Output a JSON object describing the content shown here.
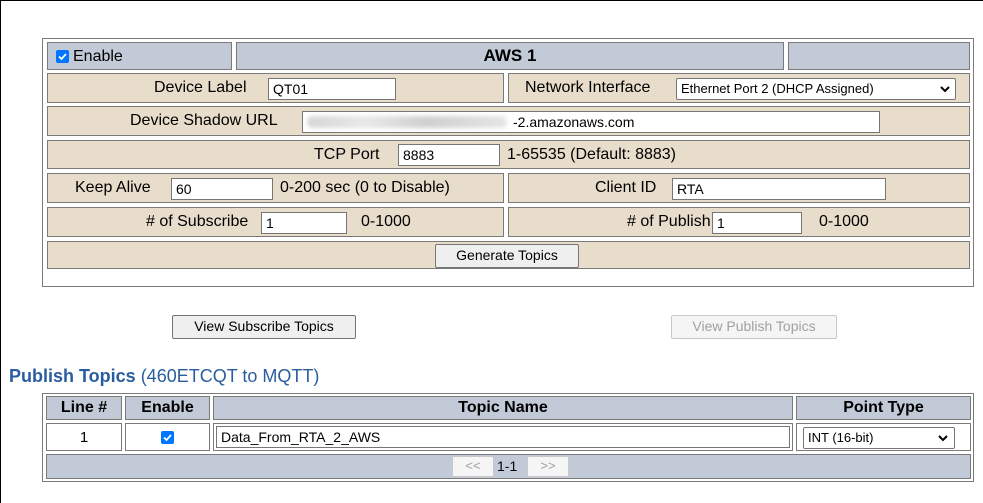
{
  "config": {
    "enable_label": "Enable",
    "enable_checked": true,
    "title": "AWS 1",
    "device_label": {
      "label": "Device Label",
      "value": "QT01"
    },
    "network_interface": {
      "label": "Network Interface",
      "value": "Ethernet Port 2 (DHCP Assigned)"
    },
    "device_shadow_url": {
      "label": "Device Shadow URL",
      "value_suffix": "-2.amazonaws.com"
    },
    "tcp_port": {
      "label": "TCP Port",
      "value": "8883",
      "hint": "1-65535 (Default: 8883)"
    },
    "keep_alive": {
      "label": "Keep Alive",
      "value": "60",
      "hint": "0-200 sec (0 to Disable)"
    },
    "client_id": {
      "label": "Client ID",
      "value": "RTA"
    },
    "num_subscribe": {
      "label": "# of Subscribe",
      "value": "1",
      "hint": "0-1000"
    },
    "num_publish": {
      "label": "# of Publish",
      "value": "1",
      "hint": "0-1000"
    },
    "generate_topics_label": "Generate Topics"
  },
  "buttons": {
    "view_subscribe_label": "View Subscribe Topics",
    "view_publish_label": "View Publish Topics"
  },
  "publish_topics": {
    "title_bold": "Publish Topics",
    "title_rest": " (460ETCQT to MQTT)",
    "columns": [
      "Line #",
      "Enable",
      "Topic Name",
      "Point Type"
    ],
    "rows": [
      {
        "line": "1",
        "enabled": true,
        "topic": "Data_From_RTA_2_AWS",
        "point_type": "INT (16-bit)"
      }
    ],
    "pager": {
      "prev": "<<",
      "range": "1-1",
      "next": ">>"
    }
  },
  "colors": {
    "header_bg": "#c2cad8",
    "row_bg": "#e8dccb",
    "section_title": "#2a5d9f",
    "checkbox": "#0075ff"
  }
}
